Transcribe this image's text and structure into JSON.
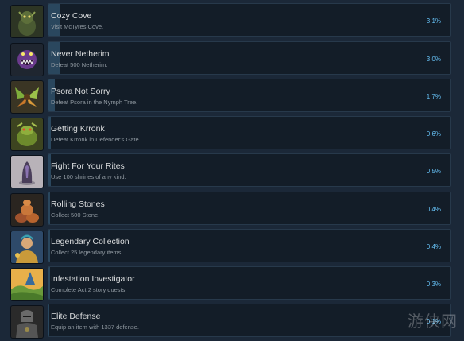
{
  "achievements": [
    {
      "icon": "mossy-golem-icon",
      "title": "Cozy Cove",
      "description": "Visit McTyres Cove.",
      "percent": "3.1%",
      "unlock_fraction": 0.031
    },
    {
      "icon": "purple-chomper-icon",
      "title": "Never Netherim",
      "description": "Defeat 500 Netherim.",
      "percent": "3.0%",
      "unlock_fraction": 0.03
    },
    {
      "icon": "nymph-wings-icon",
      "title": "Psora Not Sorry",
      "description": "Defeat Psora in the Nymph Tree.",
      "percent": "1.7%",
      "unlock_fraction": 0.017
    },
    {
      "icon": "krronk-creature-icon",
      "title": "Getting Krronk",
      "description": "Defeat Krronk in Defender's Gate.",
      "percent": "0.6%",
      "unlock_fraction": 0.006
    },
    {
      "icon": "shrine-stone-icon",
      "title": "Fight For Your Rites",
      "description": "Use 100 shrines of any kind.",
      "percent": "0.5%",
      "unlock_fraction": 0.005
    },
    {
      "icon": "stone-pile-icon",
      "title": "Rolling Stones",
      "description": "Collect 500 Stone.",
      "percent": "0.4%",
      "unlock_fraction": 0.004
    },
    {
      "icon": "hero-portrait-icon",
      "title": "Legendary Collection",
      "description": "Collect 25 legendary items.",
      "percent": "0.4%",
      "unlock_fraction": 0.004
    },
    {
      "icon": "landscape-icon",
      "title": "Infestation Investigator",
      "description": "Complete Act 2 story quests.",
      "percent": "0.3%",
      "unlock_fraction": 0.003
    },
    {
      "icon": "armored-knight-icon",
      "title": "Elite Defense",
      "description": "Equip an item with 1337 defense.",
      "percent": "0.1%",
      "unlock_fraction": 0.001
    }
  ],
  "watermark": "游侠网"
}
